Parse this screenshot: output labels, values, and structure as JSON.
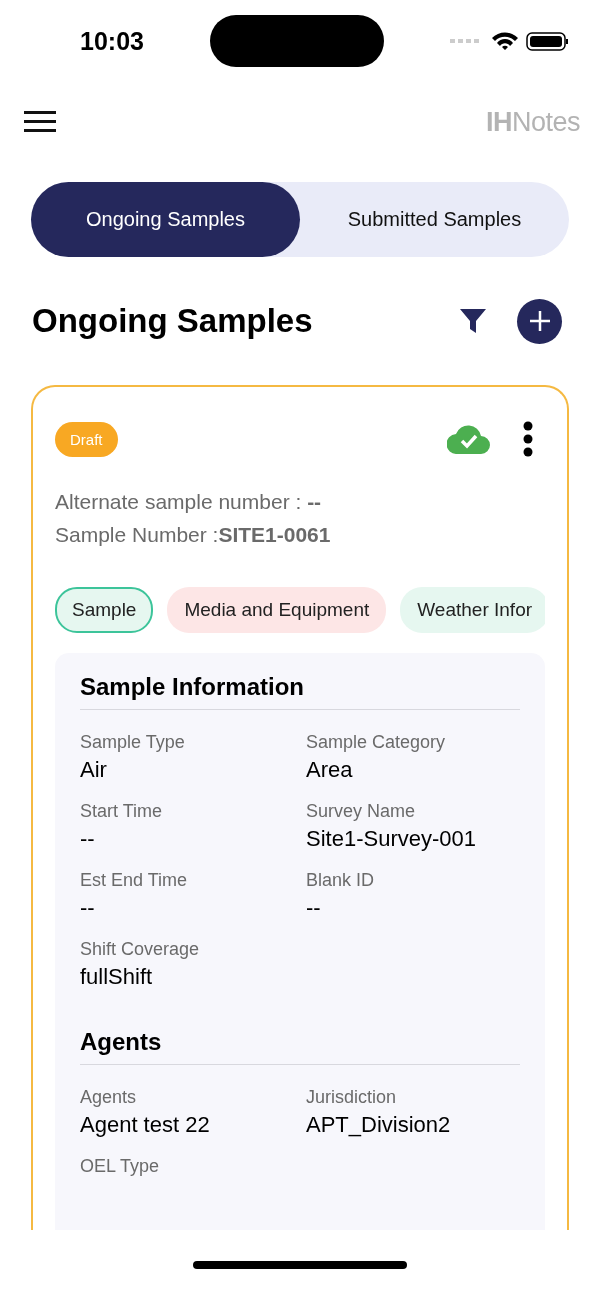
{
  "status_bar": {
    "time": "10:03"
  },
  "header": {
    "logo": "**IH**Notes"
  },
  "tabs": [
    {
      "label": "Ongoing Samples",
      "selected": true
    },
    {
      "label": "Submitted Samples",
      "selected": false
    }
  ],
  "page_title": "Ongoing Samples",
  "card": {
    "status": "Draft",
    "synced": true,
    "alternate_label": "Alternate sample number : ",
    "alternate_value": "--",
    "number_label": "Sample Number :",
    "number_value": "SITE1-0061",
    "chips": [
      {
        "label": "Sample",
        "selected": true,
        "color": "#e6f7f0"
      },
      {
        "label": "Media and Equipment",
        "selected": false,
        "color": "#fde6e6"
      },
      {
        "label": "Weather Infor",
        "selected": false,
        "color": "#e6f7f0"
      }
    ],
    "sections": [
      {
        "title": "Sample Information",
        "fields": [
          {
            "label": "Sample Type",
            "value": "Air"
          },
          {
            "label": "Sample Category",
            "value": "Area"
          },
          {
            "label": "Start Time",
            "value": "--"
          },
          {
            "label": "Survey Name",
            "value": "Site1-Survey-001"
          },
          {
            "label": "Est End Time",
            "value": "--"
          },
          {
            "label": "Blank ID",
            "value": "--"
          },
          {
            "label": "Shift Coverage",
            "value": "fullShift"
          }
        ]
      },
      {
        "title": "Agents",
        "fields": [
          {
            "label": "Agents",
            "value": "Agent test 22"
          },
          {
            "label": "Jurisdiction",
            "value": "APT_Division2"
          },
          {
            "label": "OEL Type"
          }
        ]
      }
    ]
  }
}
